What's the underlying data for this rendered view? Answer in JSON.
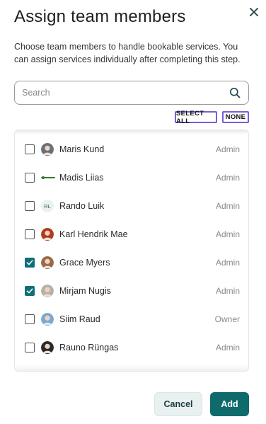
{
  "dialog": {
    "title": "Assign team members",
    "subtitle": "Choose team members to handle bookable services. You can assign services individually after completing this step."
  },
  "search": {
    "placeholder": "Search",
    "value": ""
  },
  "selection": {
    "select_all": "SELECT ALL",
    "none": "NONE"
  },
  "members": [
    {
      "name": "Maris Kund",
      "role": "Admin",
      "checked": false,
      "avatar": "photo",
      "avatar_color": "#6b6f78"
    },
    {
      "name": "Madis Liias",
      "role": "Admin",
      "checked": false,
      "avatar": "logo",
      "avatar_color": "#2e7d32"
    },
    {
      "name": "Rando Luik",
      "role": "Admin",
      "checked": false,
      "avatar": "initials",
      "initials": "RL",
      "avatar_color": "#e9f2f1"
    },
    {
      "name": "Karl Hendrik Mae",
      "role": "Admin",
      "checked": false,
      "avatar": "photo",
      "avatar_color": "#b23a1d"
    },
    {
      "name": "Grace Myers",
      "role": "Admin",
      "checked": true,
      "avatar": "photo",
      "avatar_color": "#9a6a4a"
    },
    {
      "name": "Mirjam Nugis",
      "role": "Admin",
      "checked": true,
      "avatar": "photo",
      "avatar_color": "#b9b0aa"
    },
    {
      "name": "Siim Raud",
      "role": "Owner",
      "checked": false,
      "avatar": "photo",
      "avatar_color": "#7aa8d8"
    },
    {
      "name": "Rauno Rüngas",
      "role": "Admin",
      "checked": false,
      "avatar": "photo",
      "avatar_color": "#2a2a2a"
    }
  ],
  "actions": {
    "cancel": "Cancel",
    "add": "Add"
  },
  "colors": {
    "accent": "#0f6b6b",
    "select_outline": "#7b5cd6",
    "cancel_bg": "#e8f1f0"
  }
}
